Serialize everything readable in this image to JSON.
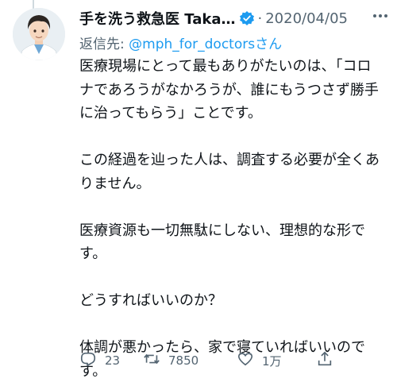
{
  "tweet": {
    "author_name": "手を洗う救急医 Taka…",
    "separator": "·",
    "date": "2020/04/05",
    "reply_prefix": "返信先: ",
    "reply_handle": "@mph_for_doctors",
    "reply_suffix": "さん",
    "text": "医療現場にとって最もありがたいのは、「コロナであろうがなかろうが、誰にもうつさず勝手に治ってもらう」ことです。\n\nこの経過を辿った人は、調査する必要が全くありません。\n\n医療資源も一切無駄にしない、理想的な形です。\n\nどうすればいいのか？\n\n体調が悪かったら、家で寝ていればいいのです。"
  },
  "actions": {
    "reply_count": "23",
    "retweet_count": "7850",
    "like_count": "1万"
  },
  "icons": {
    "verified": "verified-badge-icon",
    "more": "more-icon",
    "reply": "reply-icon",
    "retweet": "retweet-icon",
    "like": "like-icon",
    "share": "share-icon"
  },
  "colors": {
    "accent": "#1d9bf0",
    "secondary_text": "#536471",
    "text": "#0f1419"
  }
}
